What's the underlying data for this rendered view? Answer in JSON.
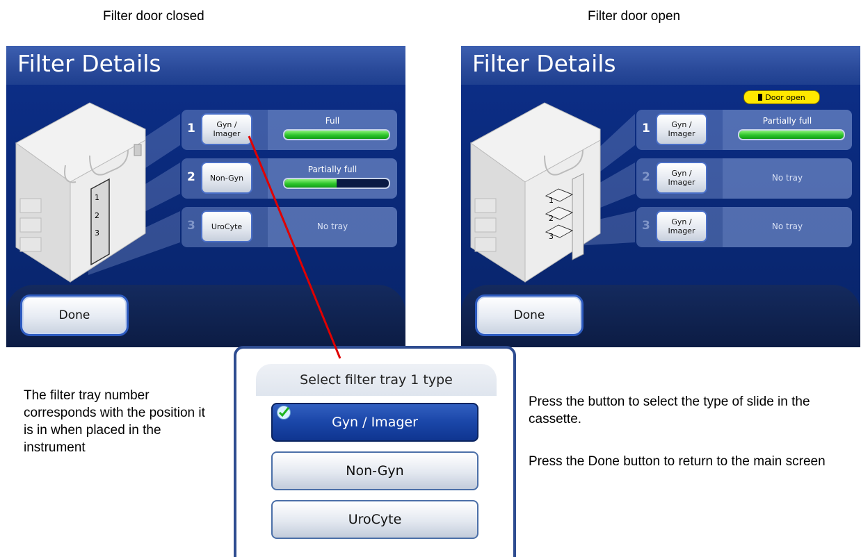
{
  "captions": {
    "left": "Filter door closed",
    "right": "Filter door open"
  },
  "screen_closed": {
    "title": "Filter Details",
    "rows": [
      {
        "num": "1",
        "type_line1": "Gyn /",
        "type_line2": "Imager",
        "status": "Full",
        "fill_fraction": 1.0
      },
      {
        "num": "2",
        "type_line1": "Non-Gyn",
        "type_line2": "",
        "status": "Partially full",
        "fill_fraction": 0.5
      },
      {
        "num": "3",
        "type_line1": "UroCyte",
        "type_line2": "",
        "status": "No tray"
      }
    ],
    "drawer_labels": [
      "1",
      "2",
      "3"
    ],
    "done_label": "Done"
  },
  "screen_open": {
    "title": "Filter Details",
    "door_badge": "Door open",
    "rows": [
      {
        "num": "1",
        "type_line1": "Gyn /",
        "type_line2": "Imager",
        "status": "Partially full",
        "fill_fraction": 1.0
      },
      {
        "num": "2",
        "type_line1": "Gyn /",
        "type_line2": "Imager",
        "status": "No tray"
      },
      {
        "num": "3",
        "type_line1": "Gyn /",
        "type_line2": "Imager",
        "status": "No tray"
      }
    ],
    "drawer_labels": [
      "1",
      "2",
      "3"
    ],
    "done_label": "Done"
  },
  "popup": {
    "header": "Select filter tray 1 type",
    "options": [
      "Gyn / Imager",
      "Non-Gyn",
      "UroCyte"
    ],
    "selected_index": 0
  },
  "notes": {
    "left_text": "The filter tray number corresponds with the position it is in when placed in the instrument",
    "right_text_1": "Press the button to select the type of slide in the cassette.",
    "right_text_2": "Press the Done button to return to the main screen"
  },
  "colors": {
    "screen_bg": "#0a2a7c",
    "bar_fill": "#2cc42a",
    "door_badge": "#ffe800",
    "pointer_line": "#e00000"
  }
}
